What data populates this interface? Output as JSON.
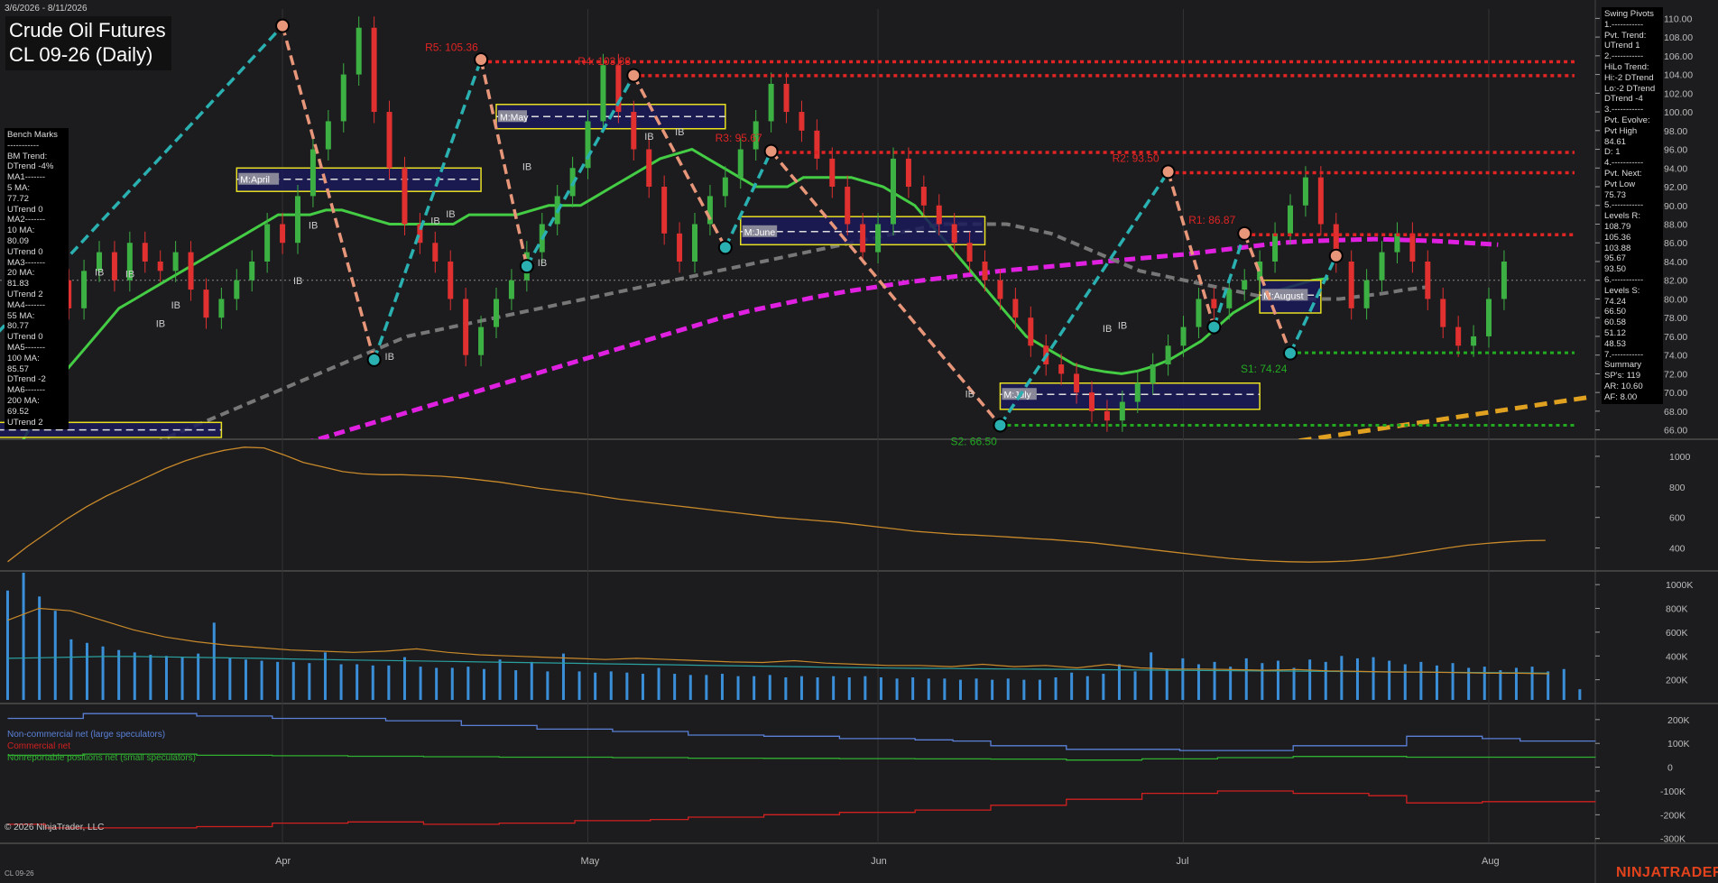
{
  "header": {
    "date_range": "3/6/2026 - 8/11/2026",
    "title": "Crude Oil Futures",
    "subtitle": "CL 09-26 (Daily)"
  },
  "bench_marks": [
    "Bench Marks",
    "-----------",
    "BM Trend:",
    "DTrend -4%",
    "MA1-------",
    "5 MA:",
    "77.72",
    "UTrend 0",
    "MA2-------",
    "10 MA:",
    "80.09",
    "UTrend 0",
    "MA3-------",
    "20 MA:",
    "81.83",
    "UTrend 2",
    "MA4-------",
    "55 MA:",
    "80.77",
    "UTrend 0",
    "MA5-------",
    "100 MA:",
    "85.57",
    "DTrend -2",
    "MA6-------",
    "200 MA:",
    "69.52",
    "UTrend 2"
  ],
  "swing_pivots": [
    "Swing Pivots",
    "1.-----------",
    "Pvt. Trend:",
    "UTrend 1",
    "2.-----------",
    "HiLo Trend:",
    "Hi:-2 DTrend",
    "Lo:-2 DTrend",
    "DTrend -4",
    "3.-----------",
    "Pvt. Evolve:",
    "Pvt High",
    "84.61",
    "D: 1",
    "4.-----------",
    "Pvt. Next:",
    "Pvt Low",
    "75.73",
    "5.-----------",
    "Levels R:",
    "108.79",
    "105.36",
    "103.88",
    "95.67",
    "93.50",
    "6.-----------",
    "Levels S:",
    "74.24",
    "66.50",
    "60.58",
    "51.12",
    "48.53",
    "7.-----------",
    "Summary",
    "SP's: 119",
    "AR: 10.60",
    "AF: 8.00"
  ],
  "cot_legend": {
    "noncommercial": "Non-commercial net (large speculators)",
    "commercial": "Commercial net",
    "nonreportable": "Nonreportable positions net (small speculators)"
  },
  "footer": {
    "copyright": "© 2026 NinjaTrader, LLC",
    "symbol": "CL 09-26",
    "brand": "NINJATRADER"
  },
  "colors": {
    "background": "#1c1c1e",
    "price_axis": "#bbbbbb",
    "resistance": "#e02424",
    "support": "#22aa22",
    "bull_candle": "#3cb043",
    "bear_candle": "#e03030",
    "swing_up": "#2ab0b0",
    "swing_down": "#e8967a",
    "ma20": "#44cc44",
    "ma55": "#777777",
    "ma100": "#e020e0",
    "ma200": "#e0a020",
    "volume": "#3a8fd8",
    "noncommercial": "#5a80d8",
    "commercial": "#d02020",
    "nonreportable": "#30b030"
  },
  "chart_data": [
    {
      "type": "candlestick",
      "name": "price",
      "ylim": [
        65,
        111
      ],
      "y_ticks": [
        "110.00",
        "108.00",
        "106.00",
        "104.00",
        "102.00",
        "100.00",
        "98.00",
        "96.00",
        "94.00",
        "92.00",
        "90.00",
        "88.00",
        "86.00",
        "84.00",
        "82.00",
        "80.00",
        "78.00",
        "76.00",
        "74.00",
        "72.00",
        "70.00",
        "68.00",
        "66.00"
      ],
      "x_labels": [
        "Apr",
        "May",
        "Jun",
        "Jul",
        "Aug"
      ],
      "x_label_days": [
        18,
        38,
        57,
        77,
        97
      ],
      "days": 104,
      "close": [
        74,
        76,
        80,
        82,
        79,
        83,
        85,
        82,
        86,
        84,
        83,
        85,
        81,
        78,
        80,
        82,
        84,
        88,
        86,
        91,
        96,
        99,
        104,
        109,
        100,
        94,
        88,
        86,
        84,
        80,
        74,
        77,
        80,
        82,
        85,
        88,
        91,
        94,
        99,
        105,
        100,
        96,
        92,
        87,
        84,
        88,
        91,
        93,
        96,
        99,
        103,
        100,
        98,
        95,
        92,
        88,
        85,
        88,
        95,
        92,
        90,
        88,
        86,
        84,
        82,
        80,
        78,
        75,
        73,
        72,
        70,
        68,
        67,
        69,
        71,
        73,
        75,
        77,
        80,
        79,
        81,
        82,
        84,
        87,
        90,
        93,
        88,
        84,
        79,
        82,
        85,
        87,
        84,
        80,
        77,
        75,
        76,
        80,
        84
      ],
      "highs_lows_note": "",
      "ma20": [
        62,
        65,
        68,
        71,
        73,
        75,
        77,
        79,
        80,
        81,
        82,
        83,
        84,
        85,
        86,
        87,
        88,
        89,
        89,
        89,
        89.5,
        89.5,
        89,
        88.5,
        88,
        88,
        88,
        88,
        88,
        89,
        89,
        89,
        89,
        89.5,
        90,
        90,
        90,
        91,
        92,
        93,
        94,
        95,
        95.5,
        96,
        95,
        94,
        93,
        92,
        92,
        92,
        93,
        93,
        93,
        93,
        92.5,
        92,
        91,
        90,
        88,
        86,
        84,
        82,
        80,
        78,
        76,
        75,
        74,
        73,
        72.5,
        72.2,
        72,
        72.3,
        72.8,
        73.5,
        74.5,
        75.5,
        77,
        78.5,
        79.5,
        80.5,
        81,
        81.5,
        82,
        82.2
      ],
      "ma55": [
        58,
        59,
        60,
        61,
        62,
        63,
        64,
        65,
        66,
        67,
        68,
        69,
        70,
        71,
        72,
        73,
        74,
        75,
        76,
        76.5,
        77,
        77.5,
        78,
        78.5,
        79,
        79.5,
        80,
        80.5,
        81,
        81.5,
        82,
        82.5,
        83,
        83.5,
        84,
        84.5,
        85,
        85.5,
        86,
        86.5,
        87,
        87.5,
        88,
        88,
        88,
        88,
        87.5,
        87,
        86,
        85,
        84,
        83,
        82.5,
        82,
        81.5,
        81,
        80.5,
        80,
        80,
        80,
        80,
        80.3,
        80.6,
        81,
        81.3
      ],
      "ma100": [
        55,
        56,
        57,
        58,
        59,
        60,
        61,
        62,
        63,
        64,
        65,
        66,
        67,
        68,
        69,
        70,
        71,
        72,
        73,
        74,
        75,
        76,
        77,
        78,
        78.8,
        79.5,
        80.2,
        80.8,
        81.3,
        81.8,
        82.2,
        82.6,
        83,
        83.3,
        83.6,
        83.9,
        84.2,
        84.5,
        84.8,
        85.2,
        85.6,
        86,
        86.2,
        86.3,
        86.4,
        86.3,
        86.2,
        86,
        85.8
      ],
      "ma200_start": [
        82,
        64.2
      ],
      "ma200_end": [
        104,
        69.6
      ],
      "swing_points": [
        [
          -2,
          74
        ],
        [
          18,
          109.2
        ],
        [
          24,
          73.5
        ],
        [
          31,
          105.6
        ],
        [
          34,
          83.5
        ],
        [
          41,
          103.9
        ],
        [
          47,
          85.5
        ],
        [
          50,
          95.8
        ],
        [
          65,
          66.5
        ],
        [
          76,
          93.6
        ],
        [
          79,
          77
        ],
        [
          81,
          87
        ],
        [
          84,
          74.2
        ],
        [
          87,
          84.6
        ]
      ],
      "resistance_levels": [
        {
          "label": "R5: 105.36",
          "value": 105.36,
          "from": 31
        },
        {
          "label": "R4: 103.88",
          "value": 103.88,
          "from": 41
        },
        {
          "label": "R3: 95.67",
          "value": 95.67,
          "from": 50
        },
        {
          "label": "R2: 93.50",
          "value": 93.5,
          "from": 76
        },
        {
          "label": "R1: 86.87",
          "value": 86.87,
          "from": 81
        }
      ],
      "support_levels": [
        {
          "label": "S1: 74.24",
          "value": 74.24,
          "from": 84
        },
        {
          "label": "S2: 66.50",
          "value": 66.5,
          "from": 65
        }
      ],
      "month_boxes": [
        {
          "label": "M:April",
          "from": 15,
          "to": 31,
          "top": 94,
          "bottom": 91.5,
          "mid": 92.8
        },
        {
          "label": "M:May",
          "from": 32,
          "to": 47,
          "top": 100.8,
          "bottom": 98.2,
          "mid": 99.5
        },
        {
          "label": "M:June",
          "from": 48,
          "to": 64,
          "top": 88.8,
          "bottom": 85.8,
          "mid": 87.2
        },
        {
          "label": "M:July",
          "from": 65,
          "to": 82,
          "top": 71,
          "bottom": 68.2,
          "mid": 69.8
        },
        {
          "label": "M:August",
          "from": 82,
          "to": 86,
          "top": 82,
          "bottom": 78.5,
          "mid": 80.4
        },
        {
          "label": "",
          "from": -3,
          "to": 14,
          "top": 66.8,
          "bottom": 65.2,
          "mid": 66
        }
      ],
      "ib_labels": [
        [
          6,
          82.5
        ],
        [
          8,
          82.3
        ],
        [
          10,
          77
        ],
        [
          11,
          79
        ],
        [
          19,
          81.6
        ],
        [
          20,
          87.5
        ],
        [
          25,
          73.5
        ],
        [
          28,
          88
        ],
        [
          29,
          88.7
        ],
        [
          34,
          93.8
        ],
        [
          35,
          83.5
        ],
        [
          42,
          97
        ],
        [
          44,
          97.5
        ],
        [
          63,
          69.5
        ],
        [
          72,
          76.5
        ],
        [
          73,
          76.8
        ]
      ],
      "reference_line": 82
    },
    {
      "type": "line",
      "name": "oscillator",
      "ylim": [
        250,
        1100
      ],
      "y_ticks": [
        "1000",
        "800",
        "600",
        "400"
      ],
      "values": [
        310,
        410,
        500,
        590,
        670,
        740,
        800,
        860,
        920,
        970,
        1010,
        1040,
        1060,
        1055,
        1010,
        960,
        930,
        900,
        885,
        880,
        880,
        875,
        870,
        860,
        845,
        830,
        810,
        790,
        775,
        760,
        740,
        720,
        705,
        690,
        675,
        660,
        645,
        630,
        615,
        600,
        590,
        580,
        570,
        555,
        540,
        525,
        510,
        500,
        490,
        485,
        478,
        470,
        462,
        455,
        445,
        435,
        420,
        405,
        390,
        375,
        360,
        345,
        332,
        322,
        315,
        310,
        308,
        310,
        315,
        325,
        340,
        360,
        380,
        400,
        418,
        430,
        440,
        448,
        450
      ]
    },
    {
      "type": "bar",
      "name": "volume",
      "ylim": [
        0,
        1100000
      ],
      "y_ticks": [
        "1000K",
        "800K",
        "600K",
        "400K",
        "200K"
      ],
      "values": [
        950000,
        1100000,
        900000,
        780000,
        540000,
        510000,
        480000,
        450000,
        430000,
        410000,
        400000,
        390000,
        420000,
        680000,
        380000,
        370000,
        360000,
        350000,
        350000,
        340000,
        430000,
        330000,
        330000,
        320000,
        320000,
        390000,
        310000,
        300000,
        300000,
        310000,
        290000,
        370000,
        280000,
        350000,
        270000,
        420000,
        270000,
        260000,
        270000,
        260000,
        250000,
        300000,
        250000,
        240000,
        240000,
        250000,
        230000,
        230000,
        240000,
        220000,
        230000,
        220000,
        230000,
        220000,
        230000,
        220000,
        210000,
        220000,
        210000,
        210000,
        200000,
        210000,
        200000,
        210000,
        200000,
        200000,
        220000,
        260000,
        230000,
        250000,
        330000,
        270000,
        430000,
        290000,
        380000,
        330000,
        350000,
        310000,
        380000,
        340000,
        360000,
        300000,
        370000,
        350000,
        400000,
        380000,
        390000,
        360000,
        330000,
        350000,
        320000,
        340000,
        300000,
        310000,
        280000,
        300000,
        310000,
        270000,
        290000,
        120000
      ],
      "ma_values": [
        380000,
        385000,
        390000,
        395000,
        395000,
        392000,
        388000,
        384000,
        380000,
        375000,
        370000,
        366000,
        362000,
        358000,
        354000,
        350000,
        346000,
        342000,
        338000,
        334000,
        330000,
        326000,
        322000,
        318000,
        314000,
        310000,
        306000,
        302000,
        298000,
        296000,
        294000,
        292000,
        290000,
        288000,
        286000,
        284000,
        282000,
        280000,
        278000,
        276000,
        274000,
        272000,
        270000,
        268000,
        266000,
        264000,
        262000,
        260000,
        258000,
        256000
      ],
      "ma2_values": [
        700000,
        800000,
        780000,
        700000,
        620000,
        560000,
        520000,
        490000,
        470000,
        450000,
        440000,
        430000,
        440000,
        460000,
        430000,
        410000,
        400000,
        390000,
        380000,
        370000,
        380000,
        370000,
        360000,
        350000,
        345000,
        360000,
        340000,
        330000,
        320000,
        320000,
        310000,
        330000,
        310000,
        320000,
        300000,
        330000,
        300000,
        290000,
        290000,
        285000,
        280000,
        285000,
        275000,
        270000,
        265000,
        265000,
        260000,
        255000,
        255000,
        250000
      ]
    },
    {
      "type": "line",
      "name": "cot",
      "ylim": [
        -320000,
        260000
      ],
      "y_ticks": [
        "200K",
        "100K",
        "0",
        "-100K",
        "-200K",
        "-300K"
      ],
      "series": [
        {
          "name": "Non-commercial net (large speculators)",
          "values": [
            205000,
            205000,
            225000,
            225000,
            225000,
            215000,
            215000,
            205000,
            205000,
            205000,
            195000,
            195000,
            175000,
            175000,
            160000,
            160000,
            150000,
            150000,
            135000,
            135000,
            130000,
            130000,
            120000,
            120000,
            115000,
            110000,
            90000,
            90000,
            75000,
            75000,
            75000,
            70000,
            70000,
            70000,
            90000,
            90000,
            90000,
            130000,
            130000,
            120000,
            110000,
            110000
          ]
        },
        {
          "name": "Commercial net",
          "values": [
            -240000,
            -255000,
            -255000,
            -255000,
            -255000,
            -250000,
            -250000,
            -235000,
            -235000,
            -230000,
            -230000,
            -240000,
            -240000,
            -235000,
            -235000,
            -225000,
            -225000,
            -220000,
            -210000,
            -210000,
            -200000,
            -200000,
            -190000,
            -190000,
            -180000,
            -180000,
            -160000,
            -160000,
            -135000,
            -135000,
            -110000,
            -110000,
            -100000,
            -100000,
            -110000,
            -110000,
            -120000,
            -150000,
            -150000,
            -145000,
            -145000,
            -145000
          ]
        },
        {
          "name": "Nonreportable positions net (small speculators)",
          "values": [
            50000,
            50000,
            55000,
            55000,
            55000,
            50000,
            50000,
            48000,
            48000,
            46000,
            46000,
            44000,
            44000,
            42000,
            42000,
            42000,
            40000,
            40000,
            38000,
            38000,
            37000,
            37000,
            36000,
            36000,
            35000,
            35000,
            34000,
            34000,
            30000,
            30000,
            35000,
            35000,
            40000,
            40000,
            45000,
            45000,
            45000,
            42000,
            42000,
            42000,
            42000,
            42000
          ]
        }
      ]
    }
  ]
}
